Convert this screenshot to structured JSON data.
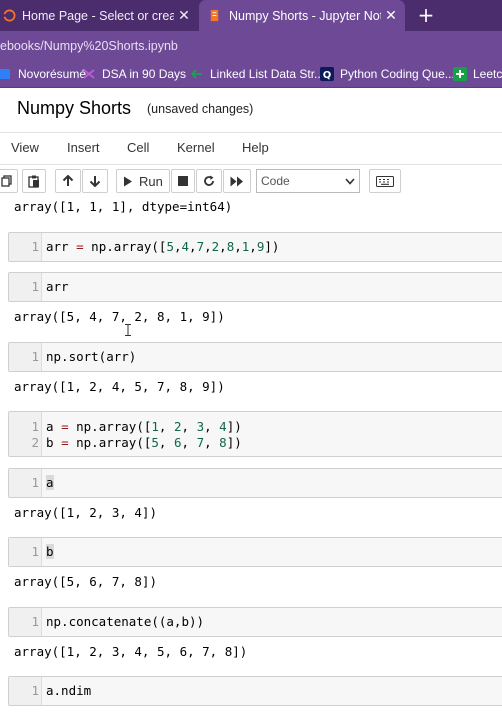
{
  "browser": {
    "tabs": [
      {
        "label": "Home Page - Select or create a n",
        "active": false
      },
      {
        "label": "Numpy Shorts - Jupyter Notebook",
        "active": true
      }
    ],
    "new_tab": "+",
    "close_glyph": "✕",
    "address": "ebooks/Numpy%20Shorts.ipynb",
    "bookmarks": [
      {
        "label": "Novorésumé",
        "icon": "novoresume-icon",
        "color": "#2f7ff7"
      },
      {
        "label": "DSA in 90 Days",
        "icon": "dsa-icon",
        "color": "#c05ad8"
      },
      {
        "label": "Linked List Data Str...",
        "icon": "linked-list-icon",
        "color": "#1aa152"
      },
      {
        "label": "Python Coding Que...",
        "icon": "python-q-icon",
        "color": "#0c1a5a"
      },
      {
        "label": "Leetco",
        "icon": "leetcode-icon",
        "color": "#18a046"
      }
    ]
  },
  "notebook": {
    "title": "Numpy Shorts",
    "status": "(unsaved changes)",
    "menu": [
      "View",
      "Insert",
      "Cell",
      "Kernel",
      "Help"
    ],
    "toolbar": {
      "run_label": "Run",
      "cell_type": "Code"
    }
  },
  "cells": {
    "out0": "array([1, 1, 1], dtype=int64)",
    "c1": {
      "ln": "1",
      "code": "arr = np.array([5,4,7,2,8,1,9])"
    },
    "c2": {
      "ln": "1",
      "code": "arr"
    },
    "out2": "array([5, 4, 7, 2, 8, 1, 9])",
    "c3": {
      "ln": "1",
      "code": "np.sort(arr)"
    },
    "out3": "array([1, 2, 4, 5, 7, 8, 9])",
    "c4": {
      "ln1": "1",
      "code1": "a = np.array([1, 2, 3, 4])",
      "ln2": "2",
      "code2": "b = np.array([5, 6, 7, 8])"
    },
    "c5": {
      "ln": "1",
      "code": "a"
    },
    "out5": "array([1, 2, 3, 4])",
    "c6": {
      "ln": "1",
      "code": "b"
    },
    "out6": "array([5, 6, 7, 8])",
    "c7": {
      "ln": "1",
      "code": "np.concatenate((a,b))"
    },
    "out7": "array([1, 2, 3, 4, 5, 6, 7, 8])",
    "c8": {
      "ln": "1",
      "code": "a.ndim"
    }
  }
}
